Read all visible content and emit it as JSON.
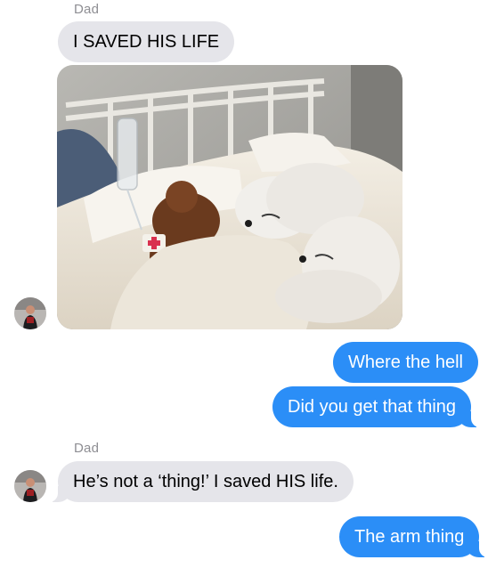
{
  "thread": {
    "messages": [
      {
        "sender": "Dad",
        "text": "I SAVED HIS LIFE"
      },
      {
        "text": "Where the hell"
      },
      {
        "text": "Did you get that thing"
      },
      {
        "sender": "Dad",
        "text": "He’s not a ‘thing!’  I saved HIS life."
      },
      {
        "text": "The arm thing"
      }
    ],
    "photo_alt": "",
    "avatar_icon": "contact-avatar",
    "colors": {
      "incoming": "#e5e5ea",
      "outgoing": "#2b8ef7",
      "sender_label": "#8e8e93"
    }
  }
}
